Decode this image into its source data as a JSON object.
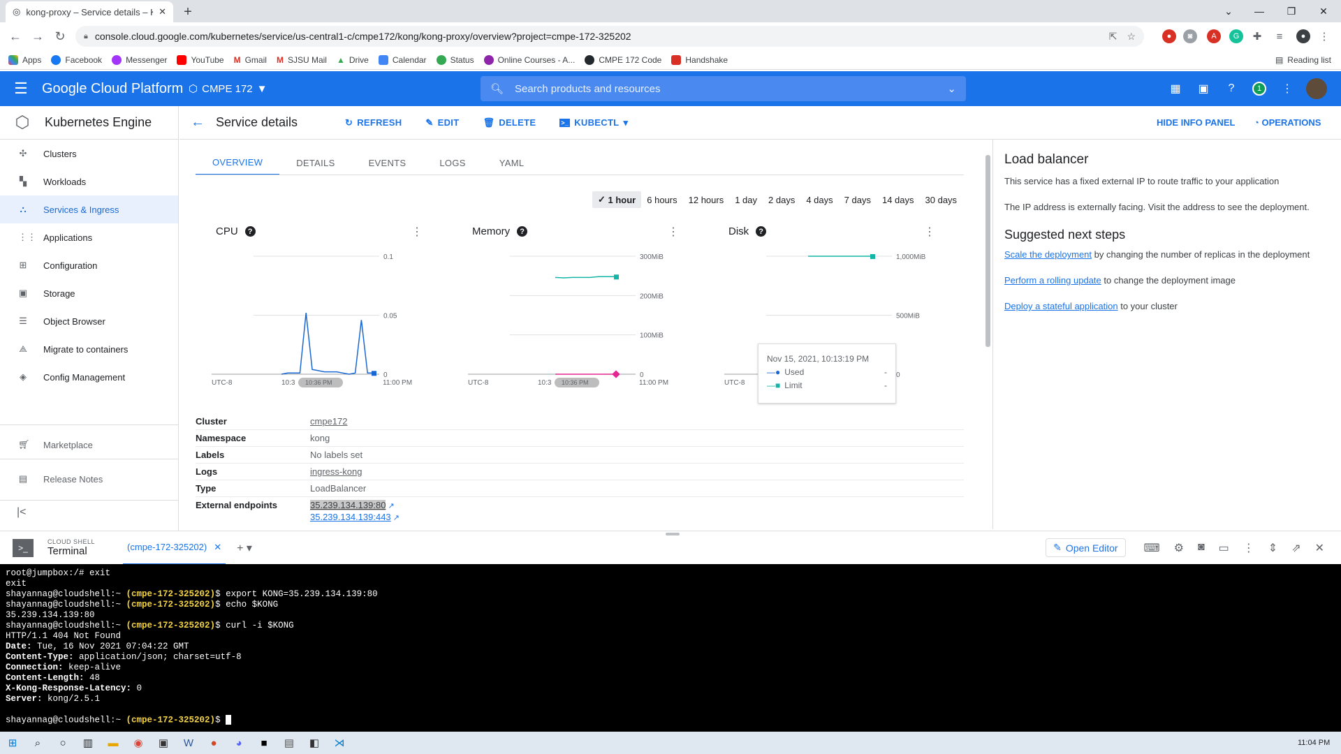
{
  "browser": {
    "tab_title": "kong-proxy – Service details – Ku",
    "new_tab": "+",
    "url": "console.cloud.google.com/kubernetes/service/us-central1-c/cmpe172/kong/kong-proxy/overview?project=cmpe-172-325202",
    "bookmarks": [
      "Apps",
      "Facebook",
      "Messenger",
      "YouTube",
      "Gmail",
      "SJSU Mail",
      "Drive",
      "Calendar",
      "Status",
      "Online Courses - A...",
      "CMPE 172 Code",
      "Handshake"
    ],
    "reading_list": "Reading list"
  },
  "gcp": {
    "brand": "Google Cloud Platform",
    "project": "CMPE 172",
    "search_placeholder": "Search products and resources",
    "notification_count": "1"
  },
  "leftnav": {
    "product": "Kubernetes Engine",
    "items": [
      "Clusters",
      "Workloads",
      "Services & Ingress",
      "Applications",
      "Configuration",
      "Storage",
      "Object Browser",
      "Migrate to containers",
      "Config Management"
    ],
    "active_index": 2,
    "bottom_items": [
      "Marketplace",
      "Release Notes"
    ]
  },
  "header": {
    "title": "Service details",
    "refresh": "REFRESH",
    "edit": "EDIT",
    "delete": "DELETE",
    "kubectl": "KUBECTL",
    "hide_info": "HIDE INFO PANEL",
    "operations": "OPERATIONS"
  },
  "tabs": [
    "OVERVIEW",
    "DETAILS",
    "EVENTS",
    "LOGS",
    "YAML"
  ],
  "time_ranges": [
    "1 hour",
    "6 hours",
    "12 hours",
    "1 day",
    "2 days",
    "4 days",
    "7 days",
    "14 days",
    "30 days"
  ],
  "selected_range": "1 hour",
  "chart_data": [
    {
      "type": "line",
      "title": "CPU",
      "y_ticks": [
        "0.1",
        "0.05",
        "0"
      ],
      "ylim": [
        0,
        0.1
      ],
      "x_ticks": [
        "UTC-8",
        "10:3",
        "10:36 PM",
        "11:00 PM"
      ],
      "series": [
        {
          "values": [
            0,
            0.001,
            0.001,
            0.001,
            0.052,
            0.004,
            0.003,
            0.002,
            0.002,
            0.002,
            0.001,
            0.0,
            0.001,
            0.046,
            0.001,
            0.001
          ]
        }
      ]
    },
    {
      "type": "line",
      "title": "Memory",
      "y_ticks": [
        "300MiB",
        "200MiB",
        "100MiB",
        "0"
      ],
      "ylim": [
        0,
        300
      ],
      "x_ticks": [
        "UTC-8",
        "10:3",
        "10:36 PM",
        "11:00 PM"
      ],
      "series": [
        {
          "name": "Limit",
          "values": [
            246,
            245,
            246,
            246,
            246,
            248,
            248,
            248
          ]
        },
        {
          "name": "Used",
          "values": [
            0,
            0,
            0,
            0,
            0,
            0,
            0,
            0
          ]
        }
      ]
    },
    {
      "type": "line",
      "title": "Disk",
      "y_ticks": [
        "1,000MiB",
        "500MiB",
        "0"
      ],
      "ylim": [
        0,
        1000
      ],
      "x_ticks": [
        "UTC-8",
        "00 PM"
      ],
      "series": [
        {
          "name": "Limit",
          "values": [
            1000,
            1000,
            1000,
            1000
          ]
        },
        {
          "name": "Used",
          "values": [
            0,
            0,
            0,
            0
          ]
        }
      ]
    }
  ],
  "tooltip": {
    "time": "Nov 15, 2021, 10:13:19 PM",
    "used": "Used",
    "limit": "Limit",
    "dash": "-"
  },
  "info": {
    "cluster_label": "Cluster",
    "cluster": "cmpe172",
    "namespace_label": "Namespace",
    "namespace": "kong",
    "labels_label": "Labels",
    "labels": "No labels set",
    "logs_label": "Logs",
    "logs": "ingress-kong",
    "type_label": "Type",
    "type": "LoadBalancer",
    "endpoints_label": "External endpoints",
    "endpoint1": "35.239.134.139:80",
    "endpoint2": "35.239.134.139:443"
  },
  "rpanel": {
    "title": "Load balancer",
    "p1": "This service has a fixed external IP to route traffic to your application",
    "p2": "The IP address is externally facing. Visit the address to see the deployment.",
    "next_title": "Suggested next steps",
    "s1_link": "Scale the deployment",
    "s1_rest": " by changing the number of replicas in the deployment",
    "s2_link": "Perform a rolling update",
    "s2_rest": " to change the deployment image",
    "s3_link": "Deploy a stateful application",
    "s3_rest": " to your cluster"
  },
  "shell": {
    "label": "CLOUD SHELL",
    "terminal": "Terminal",
    "session_tab": "(cmpe-172-325202)",
    "open_editor": "Open Editor",
    "prompt_user": "shayannag@cloudshell:~ ",
    "prompt_proj": "(cmpe-172-325202)",
    "lines": {
      "l1": "root@jumpbox:/# exit",
      "l2": "exit",
      "c1": "$ export KONG=35.239.134.139:80",
      "c2": "$ echo $KONG",
      "o1": "35.239.134.139:80",
      "c3": "$ curl -i $KONG",
      "h1": "HTTP/1.1 404 Not Found",
      "h2k": "Date:",
      "h2v": " Tue, 16 Nov 2021 07:04:22 GMT",
      "h3k": "Content-Type:",
      "h3v": " application/json; charset=utf-8",
      "h4k": "Connection:",
      "h4v": " keep-alive",
      "h5k": "Content-Length:",
      "h5v": " 48",
      "h6k": "X-Kong-Response-Latency:",
      "h6v": " 0",
      "h7k": "Server:",
      "h7v": " kong/2.5.1",
      "c4": "$ "
    }
  },
  "taskbar": {
    "clock": "11:04 PM"
  },
  "colors": {
    "gcp_blue": "#1a73e8",
    "chart_blue": "#1967d2",
    "chart_teal": "#12b5a6",
    "mem_pink": "#e52592"
  }
}
